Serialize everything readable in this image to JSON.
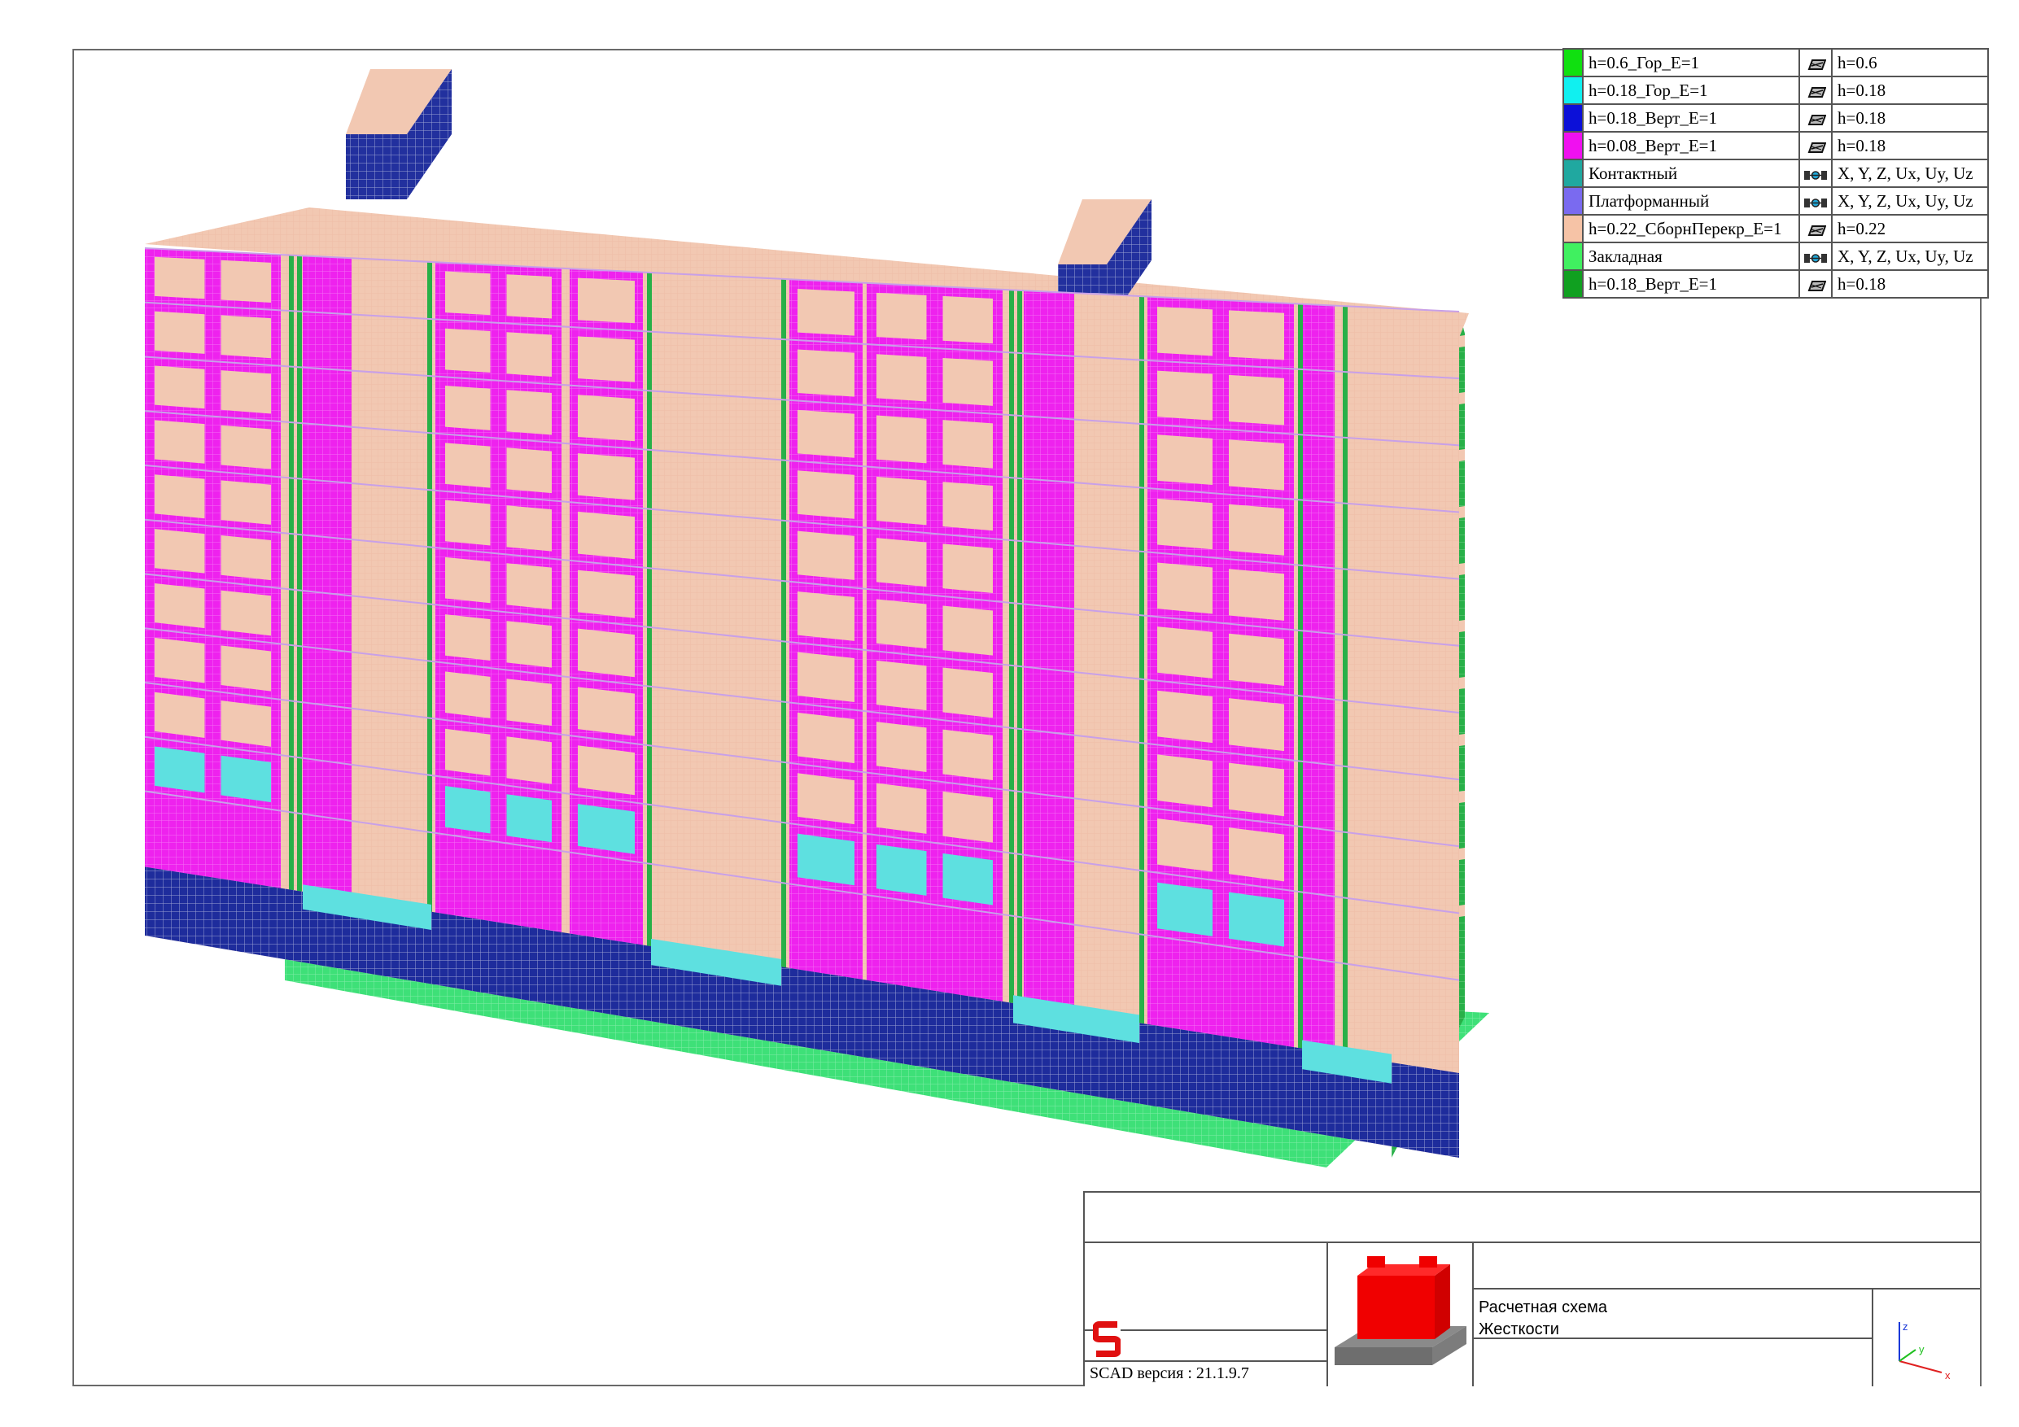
{
  "legend": [
    {
      "color": "#10e010",
      "name": "h=0.6_Гор_E=1",
      "icon": "plate-icon",
      "value": "h=0.6"
    },
    {
      "color": "#10f0f0",
      "name": "h=0.18_Гор_E=1",
      "icon": "plate-icon",
      "value": "h=0.18"
    },
    {
      "color": "#0c10d8",
      "name": "h=0.18_Верт_E=1",
      "icon": "plate-icon",
      "value": "h=0.18"
    },
    {
      "color": "#f010f0",
      "name": "h=0.08_Верт_E=1",
      "icon": "plate-icon",
      "value": "h=0.18"
    },
    {
      "color": "#20a8a0",
      "name": "Контактный",
      "icon": "link-icon",
      "value": "X, Y, Z, Ux, Uy, Uz"
    },
    {
      "color": "#7a6af0",
      "name": "Платформанный",
      "icon": "link-icon",
      "value": "X, Y, Z, Ux, Uy, Uz"
    },
    {
      "color": "#f6c3a6",
      "name": "h=0.22_СборнПерекр_E=1",
      "icon": "plate-icon",
      "value": "h=0.22"
    },
    {
      "color": "#40f060",
      "name": "Закладная",
      "icon": "link-icon",
      "value": "X, Y, Z, Ux, Uy, Uz"
    },
    {
      "color": "#10a020",
      "name": "h=0.18_Верт_E=1",
      "icon": "plate-icon",
      "value": "h=0.18"
    }
  ],
  "stamp": {
    "version": "SCAD версия : 21.1.9.7",
    "line1": "Расчетная схема",
    "line2": "Жесткости",
    "axes": {
      "z": "z",
      "y": "y",
      "x": "x"
    }
  },
  "colors": {
    "slab": "#f2c8b2",
    "wall": "#ee22ee",
    "window": "#f2c8b2",
    "base": "#1e2c9c",
    "ground": "#3ee078",
    "shaft": "#22309e",
    "glass": "#5ee0e0",
    "side": "#28b048"
  }
}
